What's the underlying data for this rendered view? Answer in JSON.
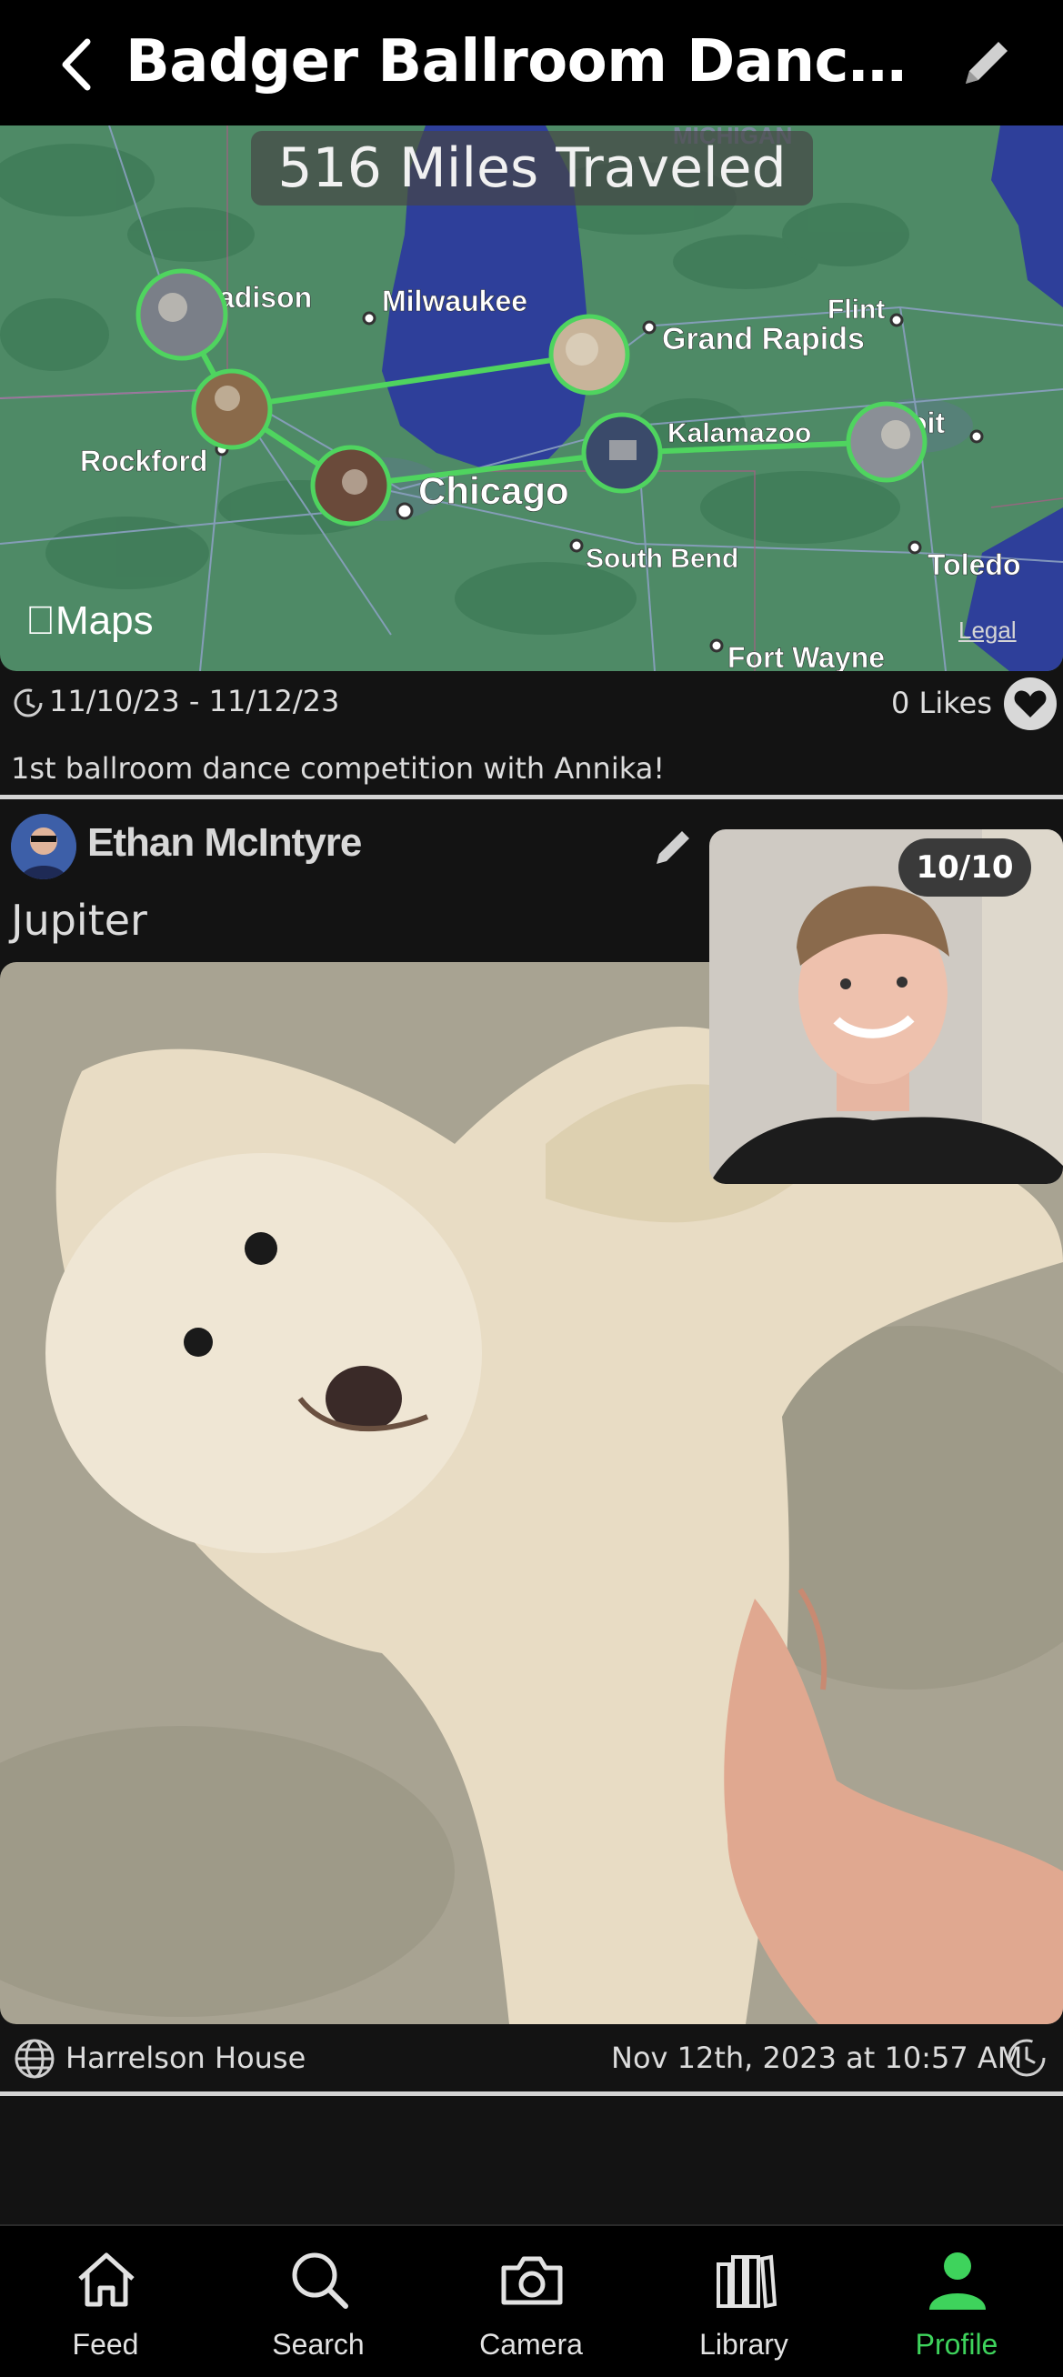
{
  "header": {
    "title": "Badger Ballroom Dances...",
    "back_icon": "chevron-left-icon",
    "edit_icon": "pencil-icon"
  },
  "map": {
    "miles_label": "516 Miles Traveled",
    "maps_logo": "Maps",
    "legal": "Legal",
    "route_color": "#4fd45f",
    "cities": [
      "Madison",
      "Milwaukee",
      "Grand Rapids",
      "Flint",
      "Rockford",
      "Chicago",
      "Kalamazoo",
      "Detroit",
      "South Bend",
      "Toledo",
      "Fort Wayne",
      "MICHIGAN"
    ]
  },
  "trip": {
    "date_range": "11/10/23 - 11/12/23",
    "likes": "0 Likes",
    "caption": "1st ballroom dance competition with Annika!"
  },
  "post": {
    "author": "Ethan McIntyre",
    "title": "Jupiter",
    "score": "10/10",
    "location": "Harrelson House",
    "timestamp": "Nov 12th, 2023 at 10:57 AM"
  },
  "tabs": [
    {
      "label": "Feed",
      "icon": "home-icon",
      "active": false
    },
    {
      "label": "Search",
      "icon": "search-icon",
      "active": false
    },
    {
      "label": "Camera",
      "icon": "camera-icon",
      "active": false
    },
    {
      "label": "Library",
      "icon": "library-icon",
      "active": false
    },
    {
      "label": "Profile",
      "icon": "person-icon",
      "active": true
    }
  ],
  "colors": {
    "accent": "#3ed35c",
    "background": "#131313",
    "header": "#000000"
  }
}
